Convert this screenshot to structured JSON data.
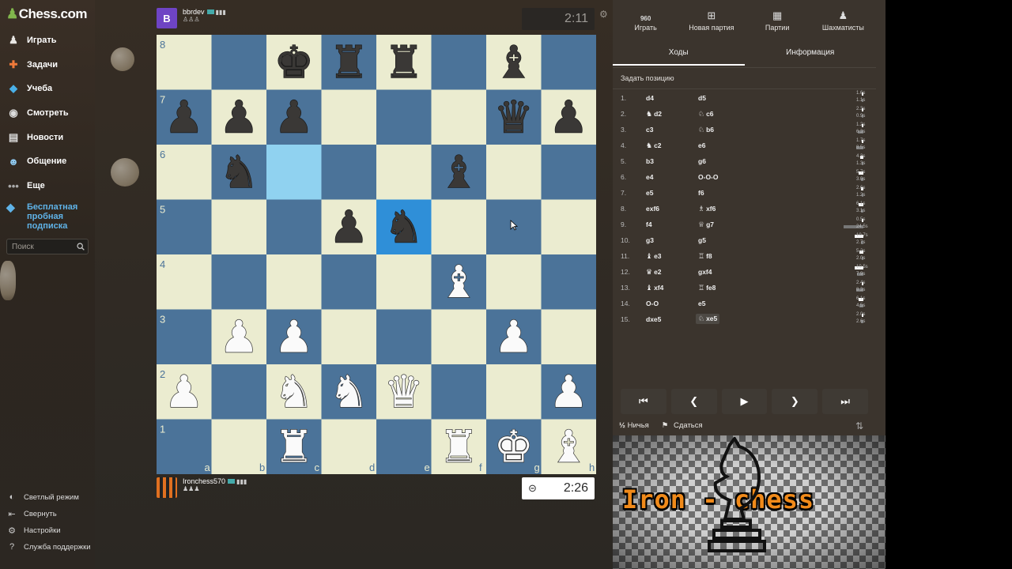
{
  "sidebar": {
    "logo": "Chess.com",
    "nav": [
      {
        "label": "Играть",
        "icon": "play-icon"
      },
      {
        "label": "Задачи",
        "icon": "puzzle-icon"
      },
      {
        "label": "Учеба",
        "icon": "learn-icon"
      },
      {
        "label": "Смотреть",
        "icon": "watch-icon"
      },
      {
        "label": "Новости",
        "icon": "news-icon"
      },
      {
        "label": "Общение",
        "icon": "social-icon"
      },
      {
        "label": "Еще",
        "icon": "more-icon"
      }
    ],
    "trial": "Бесплатная пробная подписка",
    "search_placeholder": "Поиск",
    "footer": [
      {
        "label": "Светлый режим",
        "icon": "light-mode-icon"
      },
      {
        "label": "Свернуть",
        "icon": "collapse-icon"
      },
      {
        "label": "Настройки",
        "icon": "settings-icon"
      },
      {
        "label": "Служба поддержки",
        "icon": "help-icon"
      }
    ]
  },
  "top_player": {
    "avatar_letter": "B",
    "name": "bbrdev",
    "clock": "2:11"
  },
  "bottom_player": {
    "name": "Ironchess570",
    "clock": "2:26"
  },
  "board": {
    "files": [
      "a",
      "b",
      "c",
      "d",
      "e",
      "f",
      "g",
      "h"
    ],
    "ranks": [
      "8",
      "7",
      "6",
      "5",
      "4",
      "3",
      "2",
      "1"
    ],
    "colors": {
      "light": "#ebecd0",
      "dark": "#4b7399",
      "highlight_light": "#90d2f0",
      "highlight_dark": "#2f8fd8"
    },
    "highlight_squares": [
      "c6",
      "e5"
    ],
    "pieces": {
      "c8": "bk",
      "d8": "br",
      "e8": "br",
      "g8": "bb",
      "a7": "bp",
      "b7": "bp",
      "c7": "bp",
      "g7": "bq",
      "h7": "bp",
      "b6": "bn",
      "f6": "bb",
      "d5": "bp",
      "e5": "bn",
      "f4": "wb",
      "b3": "wp",
      "c3": "wp",
      "g3": "wp",
      "a2": "wp",
      "c2": "wn",
      "d2": "wn",
      "e2": "wq",
      "h2": "wp",
      "c1": "wr",
      "f1": "wr",
      "g1": "wk",
      "h1": "wb"
    }
  },
  "panel": {
    "topnav": [
      {
        "label": "Играть",
        "icon": "play-960-icon",
        "badge": "960"
      },
      {
        "label": "Новая партия",
        "icon": "new-game-icon"
      },
      {
        "label": "Партии",
        "icon": "games-icon"
      },
      {
        "label": "Шахматисты",
        "icon": "players-icon"
      }
    ],
    "tabs": [
      "Ходы",
      "Информация"
    ],
    "set_position": "Задать позицию",
    "moves": [
      {
        "n": "1.",
        "w": "d4",
        "wp": "",
        "b": "d5",
        "bp": "",
        "wt": "1.6s",
        "bt": "1.1s"
      },
      {
        "n": "2.",
        "w": "d2",
        "wp": "♞",
        "b": "c6",
        "bp": "♘",
        "wt": "2.3s",
        "bt": "0.9s"
      },
      {
        "n": "3.",
        "w": "c3",
        "wp": "",
        "b": "b6",
        "bp": "♘",
        "wt": "1.2s",
        "bt": "6.3s"
      },
      {
        "n": "4.",
        "w": "c2",
        "wp": "♞",
        "b": "e6",
        "bp": "",
        "wt": "1.7s",
        "bt": "8.5s"
      },
      {
        "n": "5.",
        "w": "b3",
        "wp": "",
        "b": "g6",
        "bp": "",
        "wt": "4.3s",
        "bt": "1.3s"
      },
      {
        "n": "6.",
        "w": "e4",
        "wp": "",
        "b": "O-O-O",
        "bp": "",
        "wt": "5.7s",
        "bt": "3.0s"
      },
      {
        "n": "7.",
        "w": "e5",
        "wp": "",
        "b": "f6",
        "bp": "",
        "wt": "2.6s",
        "bt": "1.2s"
      },
      {
        "n": "8.",
        "w": "exf6",
        "wp": "",
        "b": "xf6",
        "bp": "♗",
        "wt": "6.1s",
        "bt": "3.1s"
      },
      {
        "n": "9.",
        "w": "f4",
        "wp": "",
        "b": "g7",
        "bp": "♕",
        "wt": "0.5s",
        "bt": "24.5s"
      },
      {
        "n": "10.",
        "w": "g3",
        "wp": "",
        "b": "g5",
        "bp": "",
        "wt": "10.7s",
        "bt": "2.7s"
      },
      {
        "n": "11.",
        "w": "e3",
        "wp": "♝",
        "b": "f8",
        "bp": "♖",
        "wt": "5.2s",
        "bt": "2.0s"
      },
      {
        "n": "12.",
        "w": "e2",
        "wp": "♛",
        "b": "gxf4",
        "bp": "",
        "wt": "10.5s",
        "bt": "7.9s"
      },
      {
        "n": "13.",
        "w": "xf4",
        "wp": "♝",
        "b": "fe8",
        "bp": "♖",
        "wt": "2.4s",
        "bt": "8.3s"
      },
      {
        "n": "14.",
        "w": "O-O",
        "wp": "",
        "b": "e5",
        "bp": "",
        "wt": "6.1s",
        "bt": "4.5s"
      },
      {
        "n": "15.",
        "w": "dxe5",
        "wp": "",
        "b": "xe5",
        "bp": "♘",
        "wt": "2.0s",
        "bt": "2.6s"
      }
    ],
    "controls": [
      "first-move-icon",
      "prev-move-icon",
      "play-icon",
      "next-move-icon",
      "last-move-icon"
    ],
    "draw": "Ничья",
    "resign": "Сдаться",
    "draw_glyph": "½"
  },
  "ad": {
    "text": "Iron - chess"
  }
}
